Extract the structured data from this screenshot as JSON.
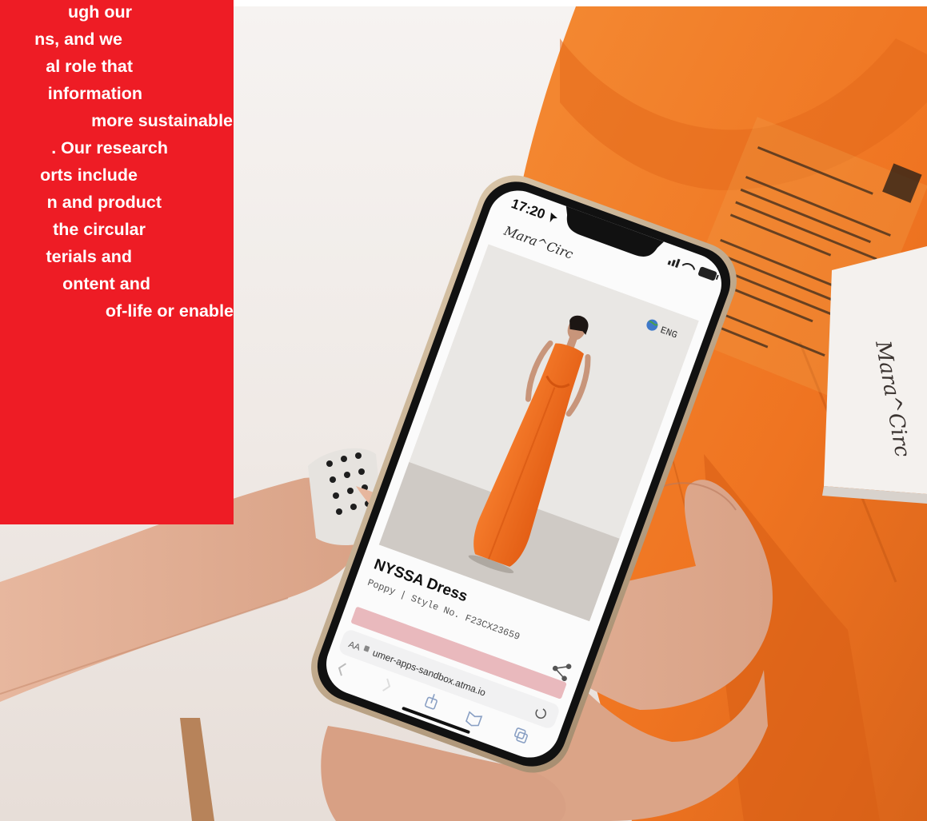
{
  "article": {
    "lines": [
      "ugh our",
      "ns, and we",
      "al role that",
      " information",
      "more sustainable",
      ". Our research",
      "orts include",
      "n and product",
      " the circular",
      "terials and",
      "ontent and",
      "of-life or enable"
    ]
  },
  "phone": {
    "time": "17:20",
    "brand_logo": "Mara^Circ",
    "language": "ENG",
    "product_name": "NYSSA Dress",
    "product_subtitle": "Poppy | Style No. F23CX23659",
    "text_size_control": "AA",
    "url": "umer-apps-sandbox.atma.io"
  },
  "tag": {
    "logo_text": "Mara^Circ"
  },
  "colors": {
    "card_red": "#ee1c25",
    "dress_orange": "#f26b1d",
    "garment_orange": "#f07a22",
    "phone_frame": "#c9b49a",
    "cta_pink": "#e9b9bd"
  },
  "icons": [
    "location-arrow-icon",
    "signal-icon",
    "wifi-icon",
    "battery-icon",
    "globe-icon",
    "share-icon",
    "lock-icon",
    "reload-icon",
    "back-arrow-icon",
    "forward-arrow-icon",
    "share-tray-icon",
    "bookmarks-icon",
    "tabs-icon"
  ]
}
